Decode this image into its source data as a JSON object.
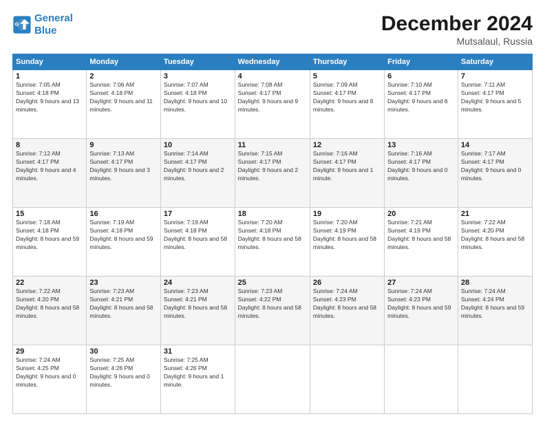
{
  "header": {
    "logo_line1": "General",
    "logo_line2": "Blue",
    "month_title": "December 2024",
    "location": "Mutsalaul, Russia"
  },
  "columns": [
    "Sunday",
    "Monday",
    "Tuesday",
    "Wednesday",
    "Thursday",
    "Friday",
    "Saturday"
  ],
  "weeks": [
    [
      {
        "day": "1",
        "sunrise": "7:05 AM",
        "sunset": "4:18 PM",
        "daylight": "9 hours and 13 minutes."
      },
      {
        "day": "2",
        "sunrise": "7:06 AM",
        "sunset": "4:18 PM",
        "daylight": "9 hours and 11 minutes."
      },
      {
        "day": "3",
        "sunrise": "7:07 AM",
        "sunset": "4:18 PM",
        "daylight": "9 hours and 10 minutes."
      },
      {
        "day": "4",
        "sunrise": "7:08 AM",
        "sunset": "4:17 PM",
        "daylight": "9 hours and 9 minutes."
      },
      {
        "day": "5",
        "sunrise": "7:09 AM",
        "sunset": "4:17 PM",
        "daylight": "9 hours and 8 minutes."
      },
      {
        "day": "6",
        "sunrise": "7:10 AM",
        "sunset": "4:17 PM",
        "daylight": "9 hours and 6 minutes."
      },
      {
        "day": "7",
        "sunrise": "7:11 AM",
        "sunset": "4:17 PM",
        "daylight": "9 hours and 5 minutes."
      }
    ],
    [
      {
        "day": "8",
        "sunrise": "7:12 AM",
        "sunset": "4:17 PM",
        "daylight": "9 hours and 4 minutes."
      },
      {
        "day": "9",
        "sunrise": "7:13 AM",
        "sunset": "4:17 PM",
        "daylight": "9 hours and 3 minutes."
      },
      {
        "day": "10",
        "sunrise": "7:14 AM",
        "sunset": "4:17 PM",
        "daylight": "9 hours and 2 minutes."
      },
      {
        "day": "11",
        "sunrise": "7:15 AM",
        "sunset": "4:17 PM",
        "daylight": "9 hours and 2 minutes."
      },
      {
        "day": "12",
        "sunrise": "7:16 AM",
        "sunset": "4:17 PM",
        "daylight": "9 hours and 1 minute."
      },
      {
        "day": "13",
        "sunrise": "7:16 AM",
        "sunset": "4:17 PM",
        "daylight": "9 hours and 0 minutes."
      },
      {
        "day": "14",
        "sunrise": "7:17 AM",
        "sunset": "4:17 PM",
        "daylight": "9 hours and 0 minutes."
      }
    ],
    [
      {
        "day": "15",
        "sunrise": "7:18 AM",
        "sunset": "4:18 PM",
        "daylight": "8 hours and 59 minutes."
      },
      {
        "day": "16",
        "sunrise": "7:19 AM",
        "sunset": "4:18 PM",
        "daylight": "8 hours and 59 minutes."
      },
      {
        "day": "17",
        "sunrise": "7:19 AM",
        "sunset": "4:18 PM",
        "daylight": "8 hours and 58 minutes."
      },
      {
        "day": "18",
        "sunrise": "7:20 AM",
        "sunset": "4:18 PM",
        "daylight": "8 hours and 58 minutes."
      },
      {
        "day": "19",
        "sunrise": "7:20 AM",
        "sunset": "4:19 PM",
        "daylight": "8 hours and 58 minutes."
      },
      {
        "day": "20",
        "sunrise": "7:21 AM",
        "sunset": "4:19 PM",
        "daylight": "8 hours and 58 minutes."
      },
      {
        "day": "21",
        "sunrise": "7:22 AM",
        "sunset": "4:20 PM",
        "daylight": "8 hours and 58 minutes."
      }
    ],
    [
      {
        "day": "22",
        "sunrise": "7:22 AM",
        "sunset": "4:20 PM",
        "daylight": "8 hours and 58 minutes."
      },
      {
        "day": "23",
        "sunrise": "7:23 AM",
        "sunset": "4:21 PM",
        "daylight": "8 hours and 58 minutes."
      },
      {
        "day": "24",
        "sunrise": "7:23 AM",
        "sunset": "4:21 PM",
        "daylight": "8 hours and 58 minutes."
      },
      {
        "day": "25",
        "sunrise": "7:23 AM",
        "sunset": "4:22 PM",
        "daylight": "8 hours and 58 minutes."
      },
      {
        "day": "26",
        "sunrise": "7:24 AM",
        "sunset": "4:23 PM",
        "daylight": "8 hours and 58 minutes."
      },
      {
        "day": "27",
        "sunrise": "7:24 AM",
        "sunset": "4:23 PM",
        "daylight": "8 hours and 59 minutes."
      },
      {
        "day": "28",
        "sunrise": "7:24 AM",
        "sunset": "4:24 PM",
        "daylight": "8 hours and 59 minutes."
      }
    ],
    [
      {
        "day": "29",
        "sunrise": "7:24 AM",
        "sunset": "4:25 PM",
        "daylight": "9 hours and 0 minutes."
      },
      {
        "day": "30",
        "sunrise": "7:25 AM",
        "sunset": "4:26 PM",
        "daylight": "9 hours and 0 minutes."
      },
      {
        "day": "31",
        "sunrise": "7:25 AM",
        "sunset": "4:26 PM",
        "daylight": "9 hours and 1 minute."
      },
      null,
      null,
      null,
      null
    ]
  ]
}
